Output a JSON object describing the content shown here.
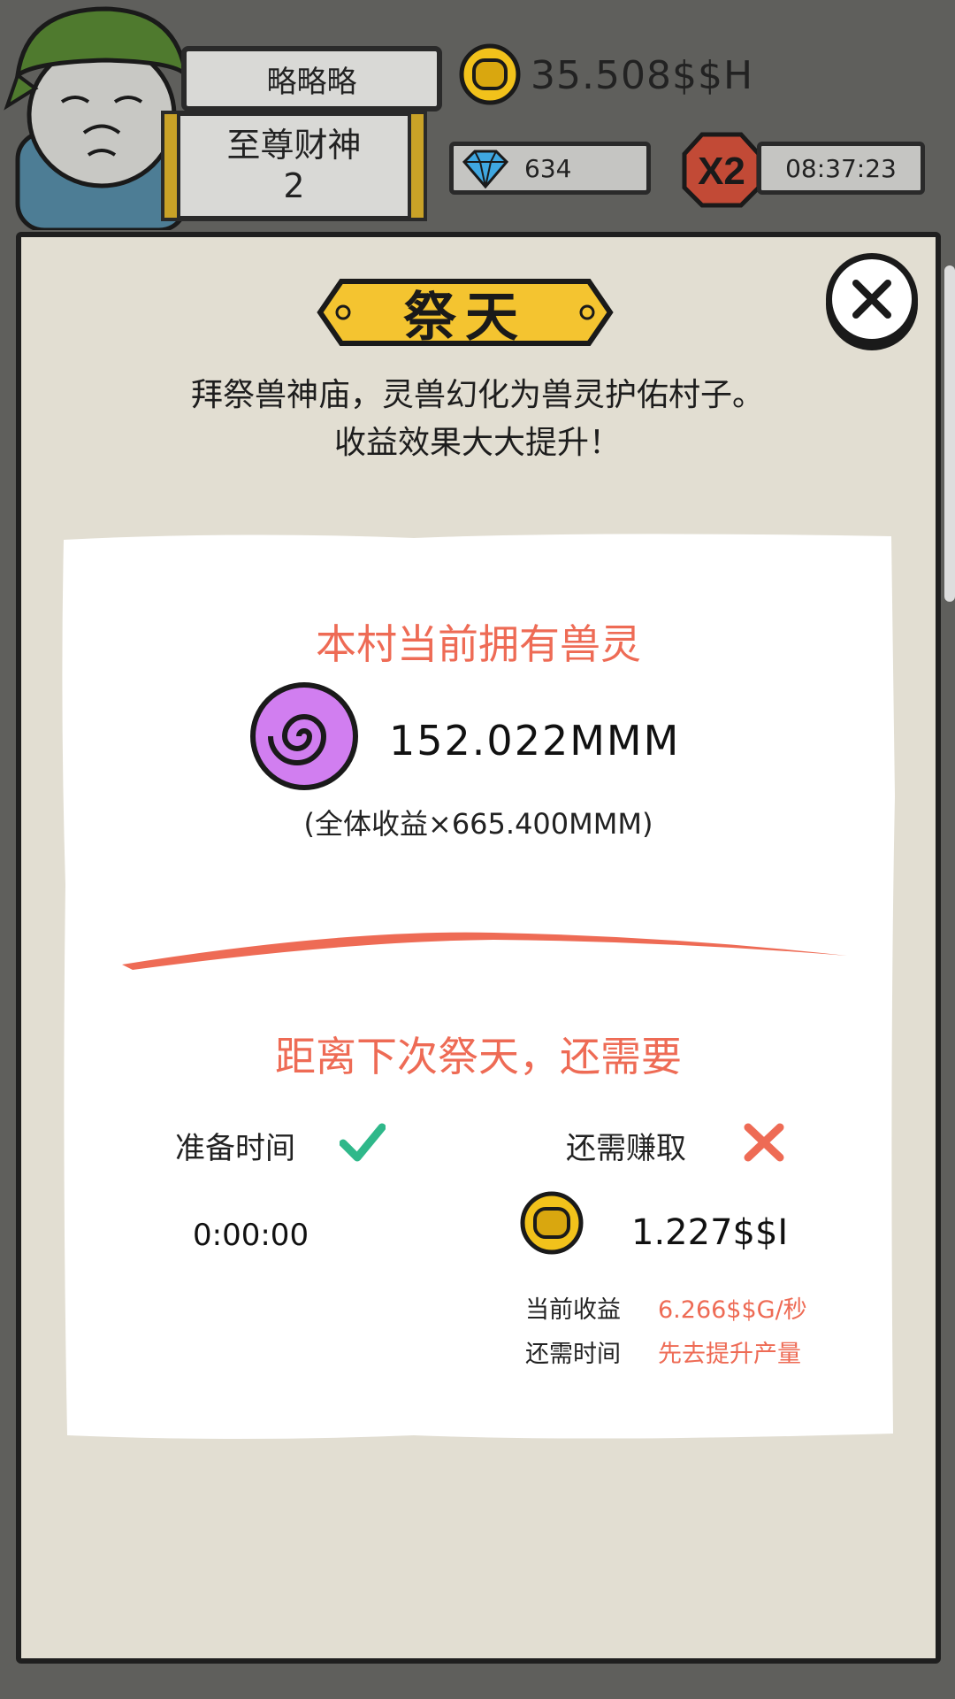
{
  "player": {
    "name": "略略略",
    "title_line1": "至尊财神",
    "title_line2": "2"
  },
  "resources": {
    "gold": "35.508$$H",
    "gems": "634",
    "boost_label": "X2",
    "boost_timer": "08:37:23"
  },
  "dialog": {
    "banner_title": "祭天",
    "description_line1": "拜祭兽神庙，灵兽幻化为兽灵护佑村子。",
    "description_line2": "收益效果大大提升！",
    "owned_title": "本村当前拥有兽灵",
    "spirit_amount": "152.022MMM",
    "bonus_text": "(全体收益×665.400MMM)",
    "next_title": "距离下次祭天，还需要",
    "ready_label": "准备时间",
    "ready_time": "0:00:00",
    "earn_label": "还需赚取",
    "earn_amount": "1.227$$I",
    "current_income_label": "当前收益",
    "current_income_value": "6.266$$G/秒",
    "time_needed_label": "还需时间",
    "time_needed_value": "先去提升产量"
  },
  "colors": {
    "accent_red": "#ee6b55",
    "banner_yellow": "#f4c430",
    "check_green": "#2fb88a",
    "spirit_purple": "#d17ef0",
    "gold": "#f2c21b"
  },
  "icons": {
    "close": "close-icon",
    "check": "check-icon",
    "cross": "cross-icon",
    "gold": "gold-coin-icon",
    "gem": "diamond-icon",
    "spirit": "spirit-swirl-icon"
  }
}
